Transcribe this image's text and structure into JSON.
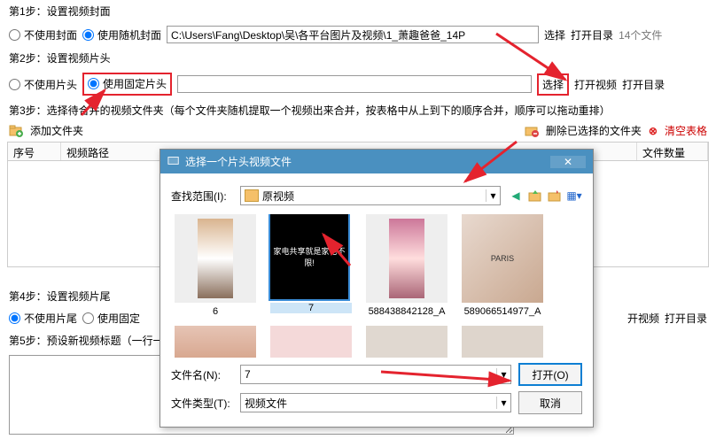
{
  "step1": {
    "label": "第1步：设置视频封面",
    "opt1": "不使用封面",
    "opt2": "使用随机封面",
    "path": "C:\\Users\\Fang\\Desktop\\吴\\各平台图片及视频\\1_萧趣爸爸_14P",
    "choose": "选择",
    "opendir": "打开目录",
    "count": "14个文件"
  },
  "step2": {
    "label": "第2步：设置视频片头",
    "opt1": "不使用片头",
    "opt2": "使用固定片头",
    "choose": "选择",
    "openvideo": "打开视频",
    "opendir": "打开目录"
  },
  "step3": {
    "label": "第3步：选择待合并的视频文件夹（每个文件夹随机提取一个视频出来合并，按表格中从上到下的顺序合并，顺序可以拖动重排）",
    "addfolder": "添加文件夹",
    "delfolder": "删除已选择的文件夹",
    "cleartable": "清空表格",
    "cols": {
      "c1": "序号",
      "c2": "视频路径",
      "c3": "文件数量"
    }
  },
  "step4": {
    "label": "第4步：设置视频片尾",
    "opt1": "不使用片尾",
    "opt2": "使用固定",
    "openvideo": "开视频",
    "opendir": "打开目录"
  },
  "step5": {
    "label": "第5步：预设新视频标题（一行一"
  },
  "dialog": {
    "title": "选择一个片头视频文件",
    "lookin": "查找范围(I):",
    "folder": "原视频",
    "filename_label": "文件名(N):",
    "filename": "7",
    "filetype_label": "文件类型(T):",
    "filetype": "视频文件",
    "open": "打开(O)",
    "cancel": "取消",
    "thumbs": [
      "6",
      "7",
      "588438842128_A",
      "589066514977_A"
    ]
  }
}
